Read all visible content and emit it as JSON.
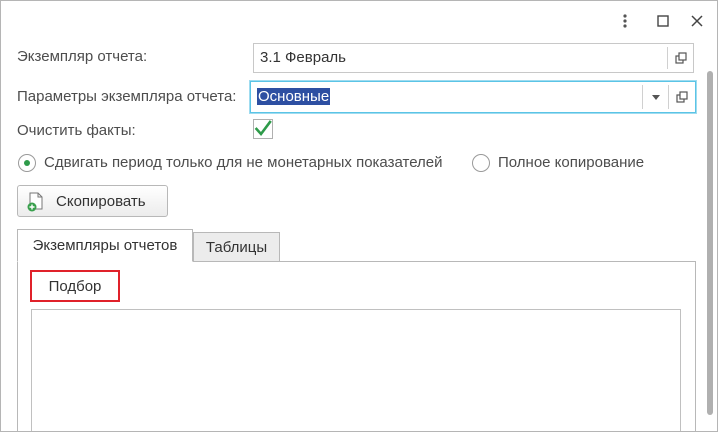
{
  "window_controls": {
    "menu_icon": "more-vertical-icon",
    "maximize_icon": "maximize-icon",
    "close_icon": "close-icon"
  },
  "form": {
    "instance_label": "Экземпляр отчета:",
    "instance_value": "3.1 Февраль",
    "params_label": "Параметры экземпляра отчета:",
    "params_value": "Основные",
    "clear_facts_label": "Очистить факты:",
    "clear_facts_checked": true,
    "radio_shift_label": "Сдвигать период только для не монетарных показателей",
    "radio_full_copy_label": "Полное копирование",
    "copy_button_label": "Скопировать"
  },
  "tabs": [
    {
      "label": "Экземпляры отчетов",
      "active": true
    },
    {
      "label": "Таблицы",
      "active": false
    }
  ],
  "panel": {
    "select_button_label": "Подбор"
  },
  "colors": {
    "checkmark": "#2e9b4a",
    "focus_border": "#5bc4e6",
    "selection": "#2d4fa2",
    "highlight_border": "#e0212a"
  }
}
